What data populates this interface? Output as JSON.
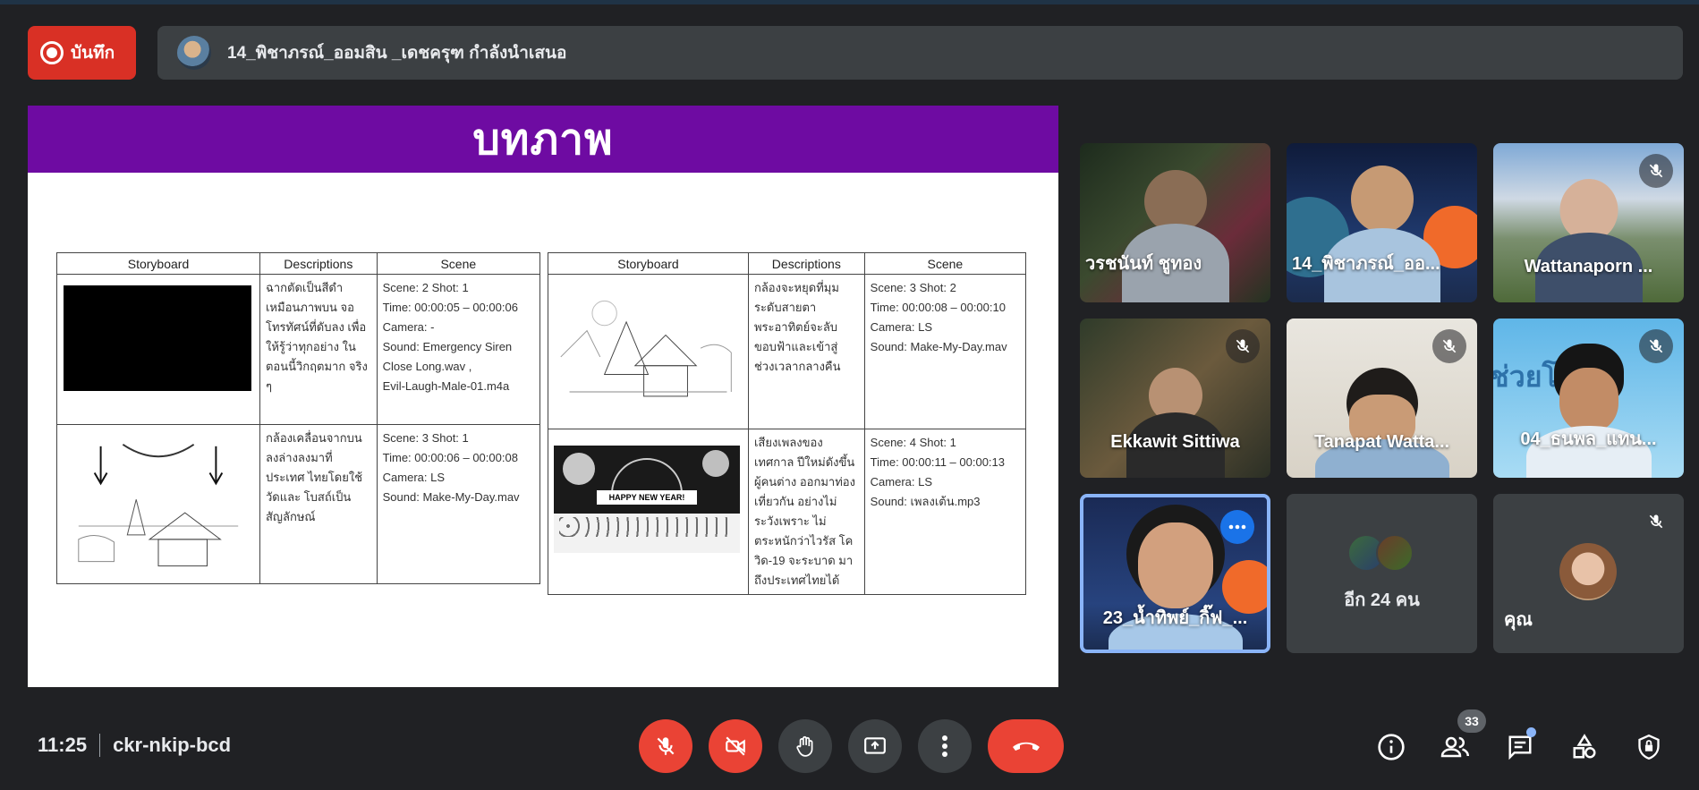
{
  "recording": {
    "label": "บันทึก",
    "icon": "record-icon"
  },
  "presenter": {
    "text": "14_พิชาภรณ์_ออมสิน _เดชครุฑ กำลังนำเสนอ"
  },
  "slide": {
    "title": "บทภาพ",
    "tables": [
      {
        "headers": [
          "Storyboard",
          "Descriptions",
          "Scene"
        ],
        "rows": [
          {
            "storyboard": "black-frame",
            "description": "ฉากตัดเป็นสีดำ เหมือนภาพบน จอโทรทัศน์ที่ดับลง เพื่อให้รู้ว่าทุกอย่าง ในตอนนี้วิกฤตมาก จริง ๆ",
            "scene": [
              "Scene: 2 Shot: 1",
              "Time: 00:00:05 – 00:00:06",
              "Camera: -",
              "Sound: Emergency Siren Close Long.wav ,",
              "Evil-Laugh-Male-01.m4a"
            ]
          },
          {
            "storyboard": "temple-arrows-sketch",
            "description": "กล้องเคลื่อนจากบน ลงล่างลงมาที่ประเทศ ไทยโดยใช้วัดและ โบสถ์เป็นสัญลักษณ์",
            "scene": [
              "Scene: 3 Shot: 1",
              "Time: 00:00:06 – 00:00:08",
              "Camera: LS",
              "Sound: Make-My-Day.mav"
            ]
          }
        ]
      },
      {
        "headers": [
          "Storyboard",
          "Descriptions",
          "Scene"
        ],
        "rows": [
          {
            "storyboard": "temple-sketch",
            "description": "กล้องจะหยุดที่มุม ระดับสายตา พระอาทิตย์จะลับ ขอบฟ้าและเข้าสู่ ช่วงเวลากลางคืน",
            "scene": [
              "Scene: 3 Shot: 2",
              "Time: 00:00:08 – 00:00:10",
              "Camera: LS",
              "Sound: Make-My-Day.mav"
            ]
          },
          {
            "storyboard": "happy-new-year-sketch",
            "banner": "HAPPY NEW YEAR!",
            "description": "เสียงเพลงของเทศกาล ปีใหม่ดังขึ้น ผู้คนต่าง ออกมาท่องเที่ยวกัน อย่างไม่ระวังเพราะ ไม่ตระหนักว่าไวรัส โควิด-19 จะระบาด มาถึงประเทศไทยได้",
            "scene": [
              "Scene: 4 Shot: 1",
              "Time: 00:00:11 – 00:00:13",
              "Camera: LS",
              "Sound: เพลงเต้น.mp3"
            ]
          }
        ]
      }
    ]
  },
  "participants": [
    {
      "name": "วรชนันท์ ชูทอง",
      "muted": false
    },
    {
      "name": "14_พิชาภรณ์_ออ...",
      "muted": false
    },
    {
      "name": "Wattanaporn ...",
      "muted": true
    },
    {
      "name": "Ekkawit Sittiwa",
      "muted": true
    },
    {
      "name": "Tanapat Watta...",
      "muted": true
    },
    {
      "name": "04_ธนพล_แทน...",
      "muted": true,
      "bg_text": "ช่วยโ"
    },
    {
      "name": "23_น้ำทิพย์_กิ๊ฟ_...",
      "muted": false,
      "active": true
    },
    {
      "name": "อีก 24 คน",
      "muted": false
    },
    {
      "name": "คุณ",
      "muted": true
    }
  ],
  "bottom": {
    "time": "11:25",
    "meeting_code": "ckr-nkip-bcd",
    "people_count": "33",
    "controls": [
      "mic-off-icon",
      "camera-off-icon",
      "raise-hand-icon",
      "present-screen-icon",
      "more-options-icon",
      "end-call-icon"
    ],
    "right_icons": [
      "info-icon",
      "people-icon",
      "chat-icon",
      "activities-icon",
      "host-controls-icon"
    ]
  },
  "colors": {
    "bg": "#202124",
    "tile": "#3c4043",
    "red": "#ea4335",
    "slide_header": "#6e0ba2",
    "accent_blue": "#1a73e8"
  }
}
